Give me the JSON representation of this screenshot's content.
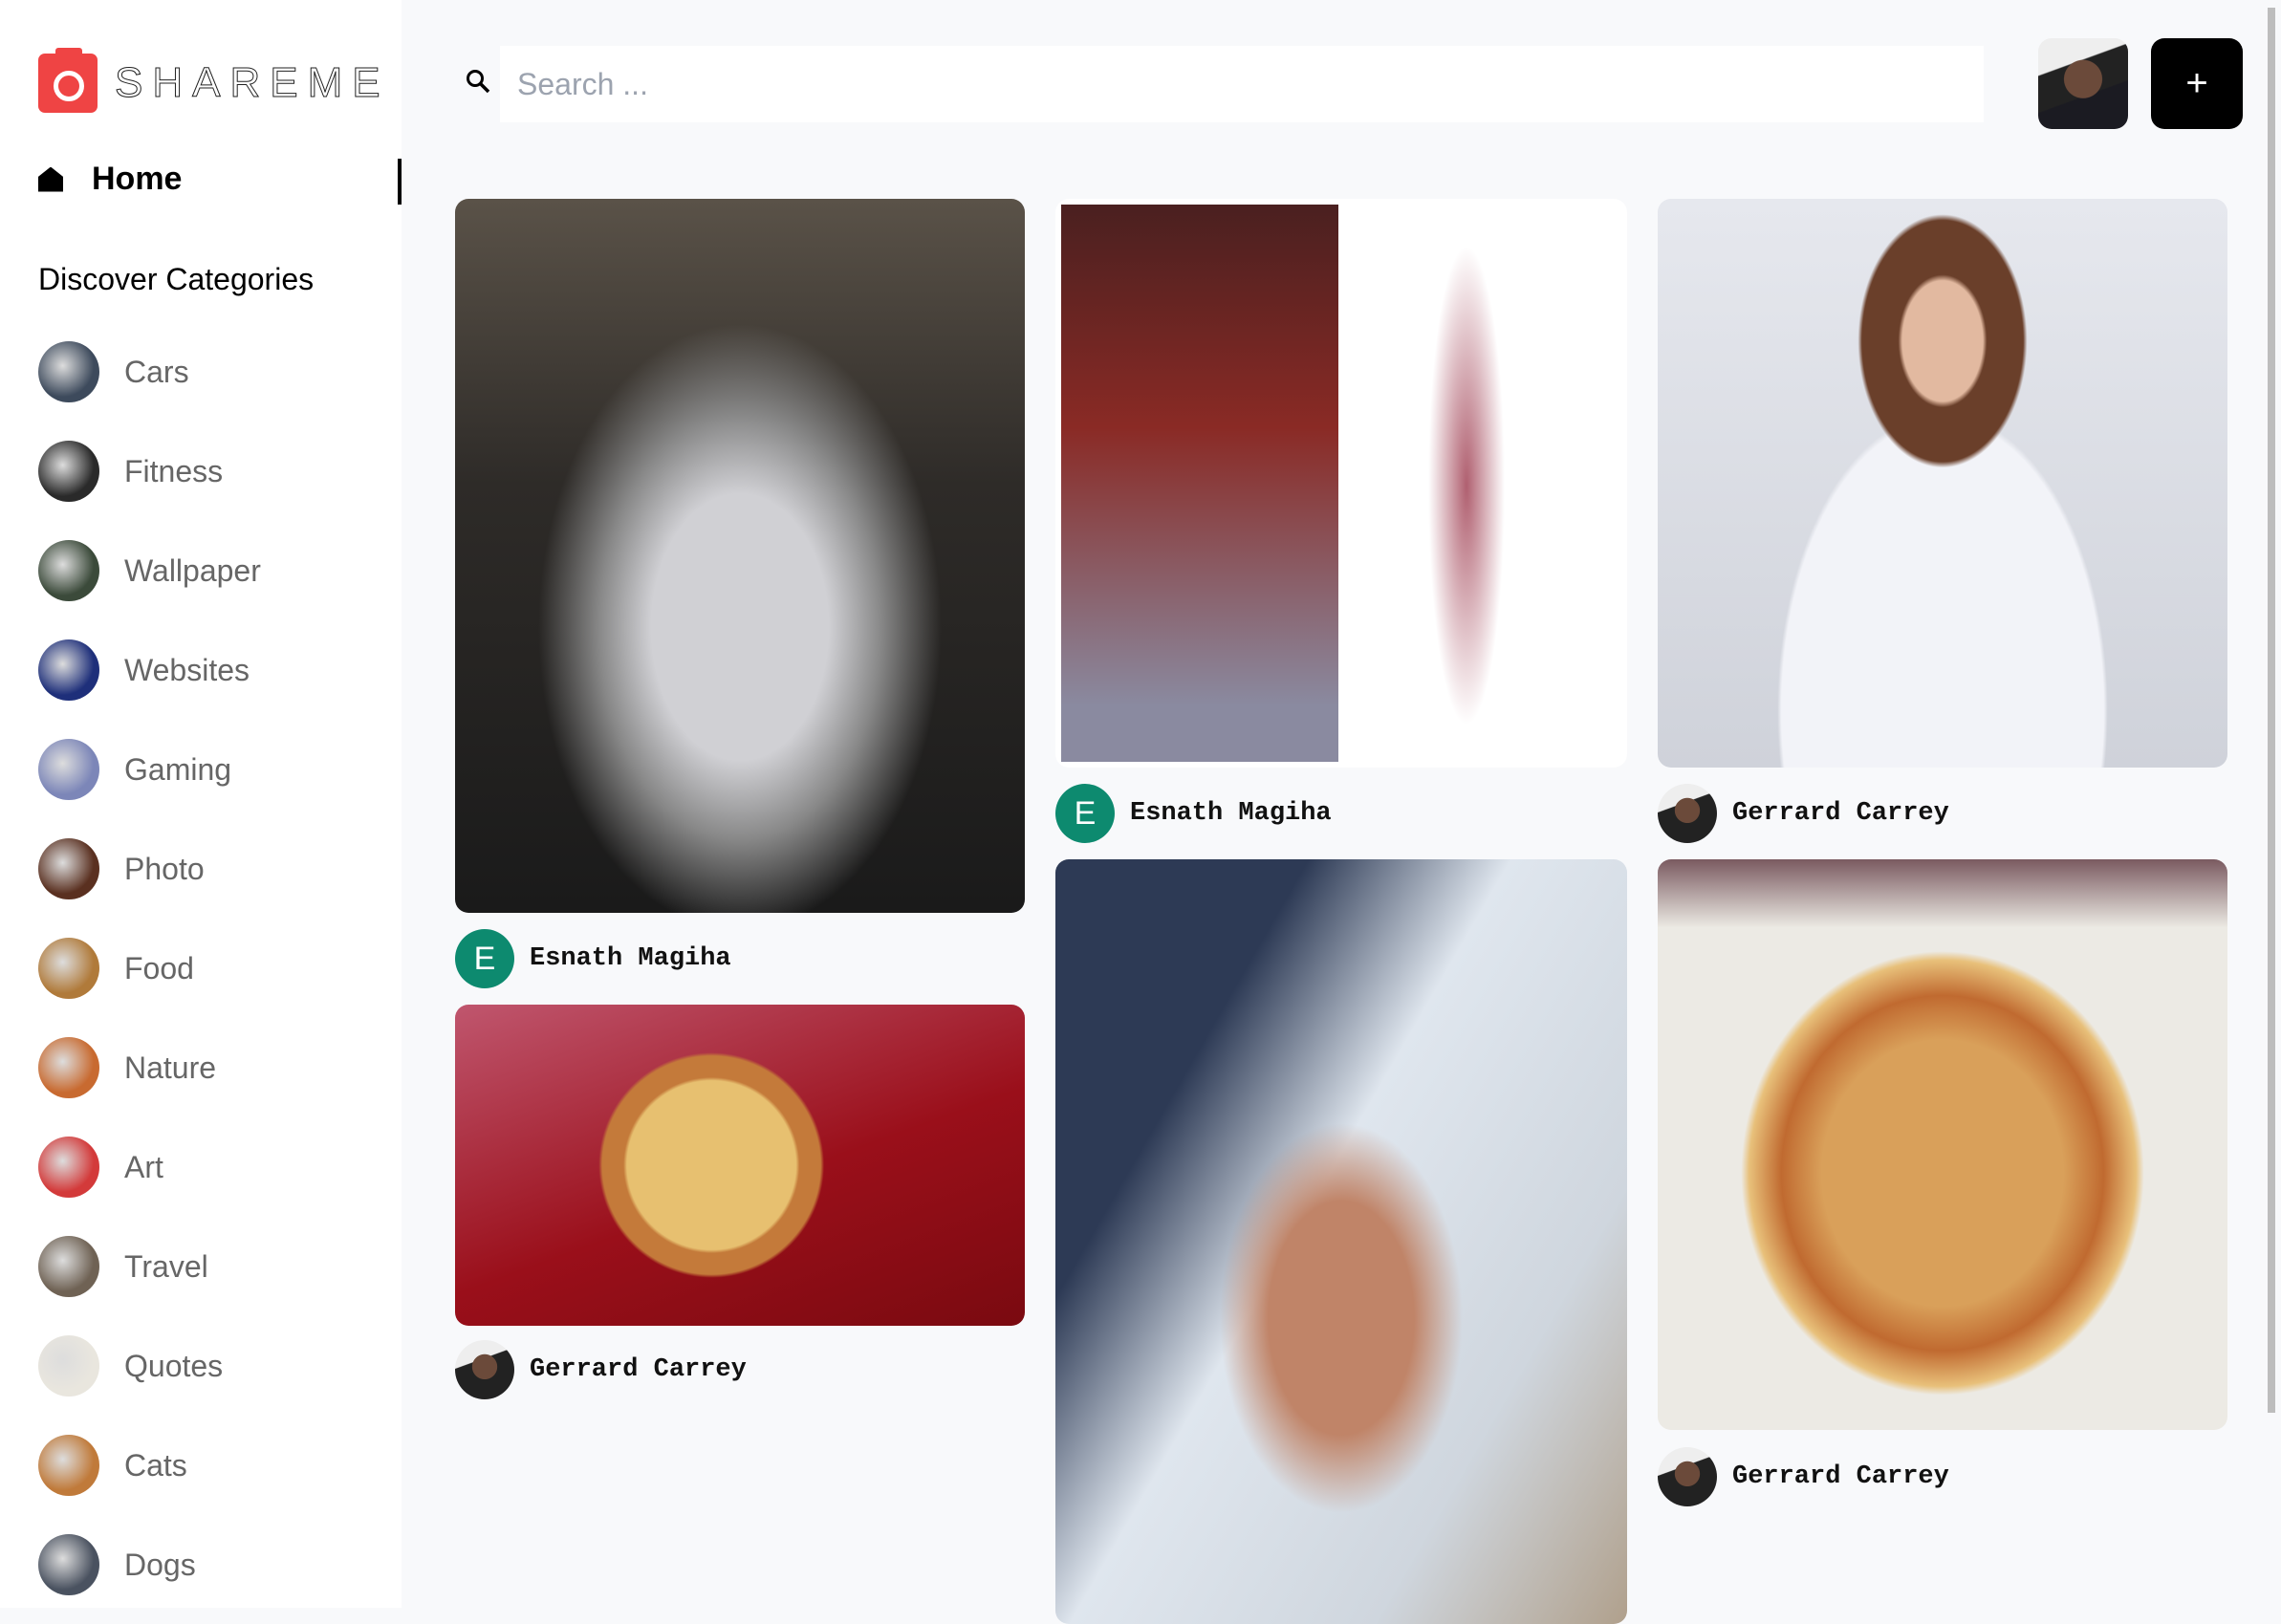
{
  "app": {
    "name": "SHAREME"
  },
  "sidebar": {
    "home": "Home",
    "discover": "Discover Categories",
    "categories": [
      {
        "label": "Cars",
        "color": "#3d4a5c"
      },
      {
        "label": "Fitness",
        "color": "#2a2a2a"
      },
      {
        "label": "Wallpaper",
        "color": "#3b4a3a"
      },
      {
        "label": "Websites",
        "color": "#1e2f7a"
      },
      {
        "label": "Gaming",
        "color": "#7c86b8"
      },
      {
        "label": "Photo",
        "color": "#5a3020"
      },
      {
        "label": "Food",
        "color": "#b07a3a"
      },
      {
        "label": "Nature",
        "color": "#c86a30"
      },
      {
        "label": "Art",
        "color": "#d33a3a"
      },
      {
        "label": "Travel",
        "color": "#6f6254"
      },
      {
        "label": "Quotes",
        "color": "#e9e6de"
      },
      {
        "label": "Cats",
        "color": "#c07a3a"
      },
      {
        "label": "Dogs",
        "color": "#4a5260"
      }
    ]
  },
  "header": {
    "search_placeholder": "Search ...",
    "add_label": "+"
  },
  "pins": [
    {
      "author": "Esnath Magiha",
      "initial": "E"
    },
    {
      "author": "Gerrard Carrey"
    },
    {
      "author": "Esnath Magiha",
      "initial": "E"
    },
    {
      "author": "Gerrard Carrey"
    },
    {
      "author": "Gerrard Carrey"
    },
    {
      "author": "Gerrard Carrey"
    }
  ]
}
